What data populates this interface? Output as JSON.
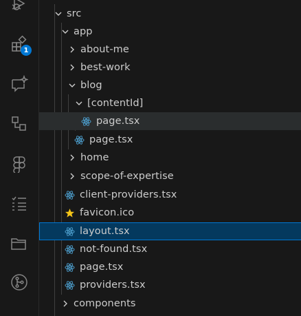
{
  "activity_bar": {
    "items": [
      {
        "name": "run-debug-icon"
      },
      {
        "name": "extensions-icon",
        "badge": "1"
      },
      {
        "name": "chat-sparkle-icon"
      },
      {
        "name": "remote-explorer-icon"
      },
      {
        "name": "figma-icon"
      },
      {
        "name": "checklist-icon"
      },
      {
        "name": "folder-icon"
      },
      {
        "name": "source-control-icon"
      }
    ]
  },
  "explorer": {
    "items": [
      {
        "label": "src",
        "kind": "folder",
        "expanded": true
      },
      {
        "label": "app",
        "kind": "folder",
        "expanded": true
      },
      {
        "label": "about-me",
        "kind": "folder",
        "expanded": false
      },
      {
        "label": "best-work",
        "kind": "folder",
        "expanded": false
      },
      {
        "label": "blog",
        "kind": "folder",
        "expanded": true
      },
      {
        "label": "[contentId]",
        "kind": "folder",
        "expanded": true
      },
      {
        "label": "page.tsx",
        "kind": "react-file",
        "state": "hover"
      },
      {
        "label": "page.tsx",
        "kind": "react-file"
      },
      {
        "label": "home",
        "kind": "folder",
        "expanded": false
      },
      {
        "label": "scope-of-expertise",
        "kind": "folder",
        "expanded": false
      },
      {
        "label": "client-providers.tsx",
        "kind": "react-file"
      },
      {
        "label": "favicon.ico",
        "kind": "favicon-file"
      },
      {
        "label": "layout.tsx",
        "kind": "react-file",
        "state": "selected"
      },
      {
        "label": "not-found.tsx",
        "kind": "react-file"
      },
      {
        "label": "page.tsx",
        "kind": "react-file"
      },
      {
        "label": "providers.tsx",
        "kind": "react-file"
      },
      {
        "label": "components",
        "kind": "folder",
        "expanded": false
      }
    ]
  },
  "colors": {
    "background": "#181818",
    "text": "#cccccc",
    "selection_bg": "#04395e",
    "selection_border": "#0078d4",
    "hover_bg": "#2a2d2e",
    "react_icon": "#4d9fce",
    "favicon_star": "#f5c518",
    "badge_bg": "#0078d4"
  }
}
